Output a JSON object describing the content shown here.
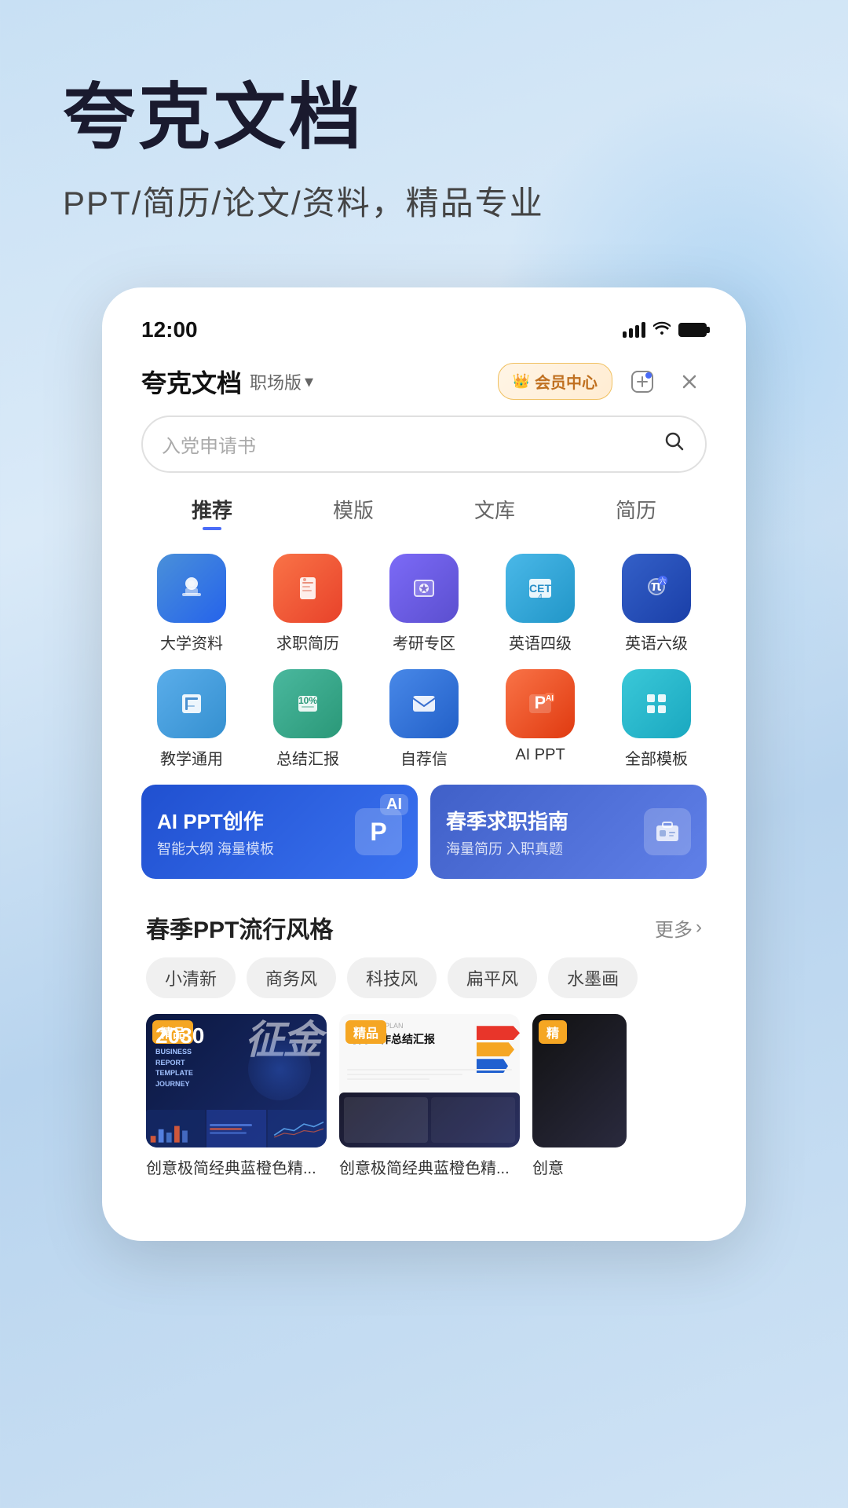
{
  "app": {
    "name": "夸克文档",
    "version_label": "职场版",
    "version_arrow": "▾",
    "vip_icon": "👑",
    "vip_label": "会员中心",
    "hero_title": "夸克文档",
    "hero_subtitle": "PPT/简历/论文/资料，精品专业",
    "status_time": "12:00"
  },
  "header": {
    "add_icon": "⊕",
    "close_icon": "✕"
  },
  "search": {
    "placeholder": "入党申请书"
  },
  "tabs": [
    {
      "label": "推荐",
      "active": true
    },
    {
      "label": "模版",
      "active": false
    },
    {
      "label": "文库",
      "active": false
    },
    {
      "label": "简历",
      "active": false
    }
  ],
  "icons": [
    {
      "id": "college",
      "label": "大学资料",
      "color_class": "ic-blue",
      "emoji": "🔵"
    },
    {
      "id": "resume",
      "label": "求职简历",
      "color_class": "ic-red",
      "emoji": "📋"
    },
    {
      "id": "graduate",
      "label": "考研专区",
      "color_class": "ic-purple",
      "emoji": "🎓"
    },
    {
      "id": "cet4",
      "label": "英语四级",
      "color_class": "ic-cyan",
      "emoji": "📝"
    },
    {
      "id": "cet6",
      "label": "英语六级",
      "color_class": "ic-darkblue",
      "emoji": "π"
    },
    {
      "id": "teaching",
      "label": "教学通用",
      "color_class": "ic-lightblue",
      "emoji": "📖"
    },
    {
      "id": "summary",
      "label": "总结汇报",
      "color_class": "ic-green",
      "emoji": "📊"
    },
    {
      "id": "cover",
      "label": "自荐信",
      "color_class": "ic-blue2",
      "emoji": "✉️"
    },
    {
      "id": "aippt",
      "label": "AI PPT",
      "color_class": "ic-orange",
      "emoji": "P"
    },
    {
      "id": "all",
      "label": "全部模板",
      "color_class": "ic-teal",
      "emoji": "⊞"
    }
  ],
  "banners": [
    {
      "id": "ai-ppt",
      "title": "AI PPT创作",
      "subtitle": "智能大纲 海量模板",
      "ai_label": "AI"
    },
    {
      "id": "job-guide",
      "title": "春季求职指南",
      "subtitle": "海量简历 入职真题"
    }
  ],
  "section": {
    "title": "春季PPT流行风格",
    "more_label": "更多",
    "more_icon": "›"
  },
  "style_tags": [
    {
      "label": "小清新",
      "active": false
    },
    {
      "label": "商务风",
      "active": false
    },
    {
      "label": "科技风",
      "active": false
    },
    {
      "label": "扁平风",
      "active": false
    },
    {
      "label": "水墨画",
      "active": false
    }
  ],
  "templates": [
    {
      "id": "t1",
      "badge": "精品",
      "name": "创意极简经典蓝橙色精...",
      "year": "2030",
      "line1": "BUSINESS",
      "line2": "REPORT",
      "line3": "TEMPLATE",
      "line4": "JOURNEY",
      "calligraphy": "征金"
    },
    {
      "id": "t2",
      "badge": "精品",
      "name": "创意极简经典蓝橙色精...",
      "header_text": "BUSINESS PLAN",
      "subtitle_text": "时尚工作总结汇报"
    },
    {
      "id": "t3",
      "badge": "精",
      "name": "创意",
      "is_partial": true
    }
  ]
}
